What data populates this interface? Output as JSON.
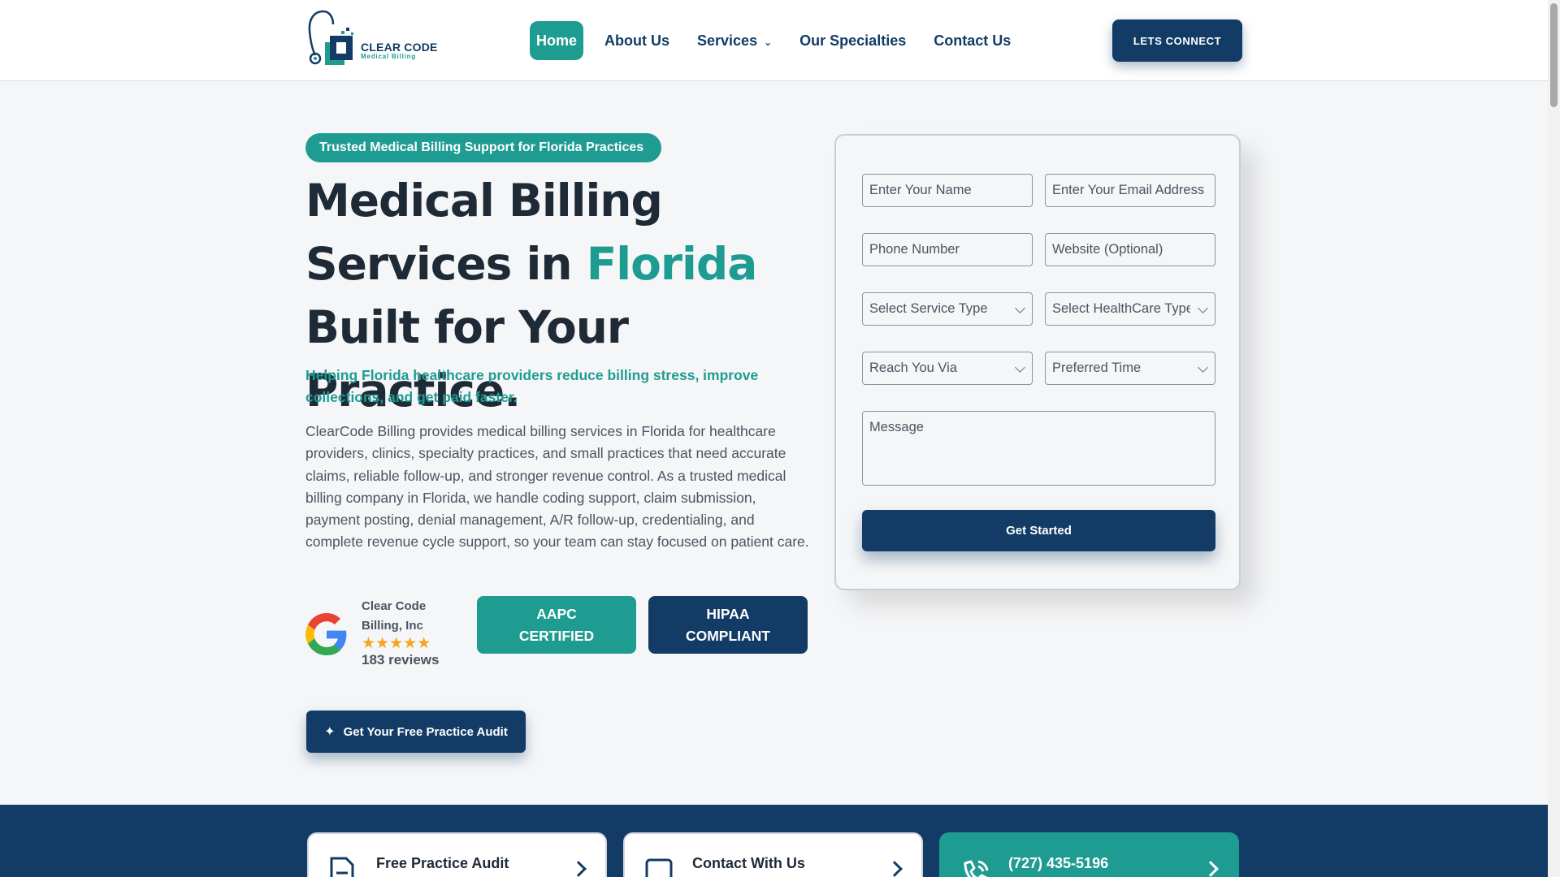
{
  "header": {
    "logo": {
      "line1": "CLEAR CODE",
      "line2": "Medical Billing"
    },
    "nav": [
      {
        "label": "Home",
        "active": true
      },
      {
        "label": "About Us"
      },
      {
        "label": "Services",
        "has_dropdown": true
      },
      {
        "label": "Our Specialties"
      },
      {
        "label": "Contact Us"
      }
    ],
    "cta_label": "LETS CONNECT"
  },
  "hero": {
    "badge": "Trusted Medical Billing Support for Florida Practices",
    "title_line1": "Medical Billing",
    "title_line2_pre": "Services in ",
    "title_line2_accent": "Florida",
    "title_line3": "Built for Your Practice.",
    "tagline": "Helping Florida healthcare providers reduce billing stress, improve collections, and get paid faster.",
    "description": "ClearCode Billing provides medical billing services in Florida for healthcare providers, clinics, specialty practices, and small practices that need accurate claims, reliable follow-up, and stronger revenue control. As a trusted medical billing company in Florida, we handle coding support, claim submission, payment posting, denial management, A/R follow-up, credentialing, and complete revenue cycle support, so your team can stay focused on patient care.",
    "review": {
      "name": "Clear Code Billing, Inc",
      "rating": 5,
      "stars": "★★★★★",
      "count_label": "183 reviews"
    },
    "certs": [
      {
        "line1": "AAPC",
        "line2": "CERTIFIED"
      },
      {
        "line1": "HIPAA",
        "line2": "COMPLIANT"
      }
    ],
    "audit_button": "Get Your Free Practice Audit"
  },
  "form": {
    "name_placeholder": "Enter Your Name",
    "email_placeholder": "Enter Your Email Address",
    "phone_placeholder": "Phone Number",
    "website_placeholder": "Website (Optional)",
    "service_select": "Select Service Type",
    "healthcare_select": "Select HealthCare Type",
    "reach_select": "Reach You Via",
    "time_select": "Preferred Time",
    "message_placeholder": "Message",
    "submit_label": "Get Started"
  },
  "quick_links": [
    {
      "label": "Free Practice Audit",
      "icon": "document-icon"
    },
    {
      "label": "Contact With Us",
      "icon": "chat-icon"
    },
    {
      "label": "(727) 435-5196",
      "icon": "phone-icon"
    }
  ],
  "colors": {
    "navy": "#123c66",
    "teal": "#1f9c92",
    "star": "#f4a51c",
    "text": "#1f2a37"
  }
}
